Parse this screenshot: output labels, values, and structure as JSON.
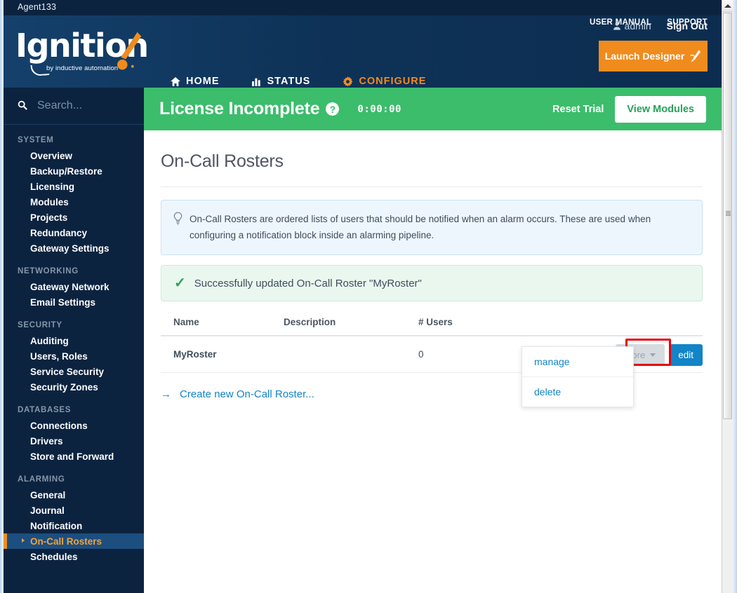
{
  "window": {
    "title": "Agent133"
  },
  "header": {
    "top_links": [
      "USER MANUAL",
      "SUPPORT"
    ],
    "user": "admin",
    "sign_out": "Sign Out",
    "logo_text": "Ignition",
    "logo_tagline": "by inductive automation",
    "nav": [
      {
        "label": "HOME",
        "icon": "home-icon",
        "active": false
      },
      {
        "label": "STATUS",
        "icon": "chart-bars-icon",
        "active": false
      },
      {
        "label": "CONFIGURE",
        "icon": "gear-icon",
        "active": true
      }
    ],
    "launch_designer": "Launch Designer"
  },
  "sidebar": {
    "search_placeholder": "Search...",
    "groups": [
      {
        "label": "SYSTEM",
        "items": [
          "Overview",
          "Backup/Restore",
          "Licensing",
          "Modules",
          "Projects",
          "Redundancy",
          "Gateway Settings"
        ]
      },
      {
        "label": "NETWORKING",
        "items": [
          "Gateway Network",
          "Email Settings"
        ]
      },
      {
        "label": "SECURITY",
        "items": [
          "Auditing",
          "Users, Roles",
          "Service Security",
          "Security Zones"
        ]
      },
      {
        "label": "DATABASES",
        "items": [
          "Connections",
          "Drivers",
          "Store and Forward"
        ]
      },
      {
        "label": "ALARMING",
        "items": [
          "General",
          "Journal",
          "Notification",
          "On-Call Rosters",
          "Schedules"
        ]
      }
    ],
    "active_item": "On-Call Rosters"
  },
  "license_bar": {
    "title": "License Incomplete",
    "help_glyph": "?",
    "timer": "0:00:00",
    "reset_trial": "Reset Trial",
    "view_modules": "View Modules"
  },
  "page": {
    "title": "On-Call Rosters",
    "info_text": "On-Call Rosters are ordered lists of users that should be notified when an alarm occurs. These are used when configuring a notification block inside an alarming pipeline.",
    "success_text": "Successfully updated On-Call Roster \"MyRoster\"",
    "create_link": "Create new On-Call Roster..."
  },
  "table": {
    "columns": [
      "Name",
      "Description",
      "# Users"
    ],
    "rows": [
      {
        "name": "MyRoster",
        "description": "",
        "users": "0"
      }
    ],
    "more_label": "More",
    "edit_label": "edit",
    "dropdown_items": [
      "manage",
      "delete"
    ]
  },
  "colors": {
    "brand_orange": "#f08c1e",
    "header_navy": "#0d3355",
    "titlebar_navy": "#0c2340",
    "sidebar_navy": "#0c2340",
    "sidebar_active": "#1d4e80",
    "license_green": "#3bbd6b",
    "link_blue": "#1284c7",
    "highlight_red": "#e8000d"
  }
}
